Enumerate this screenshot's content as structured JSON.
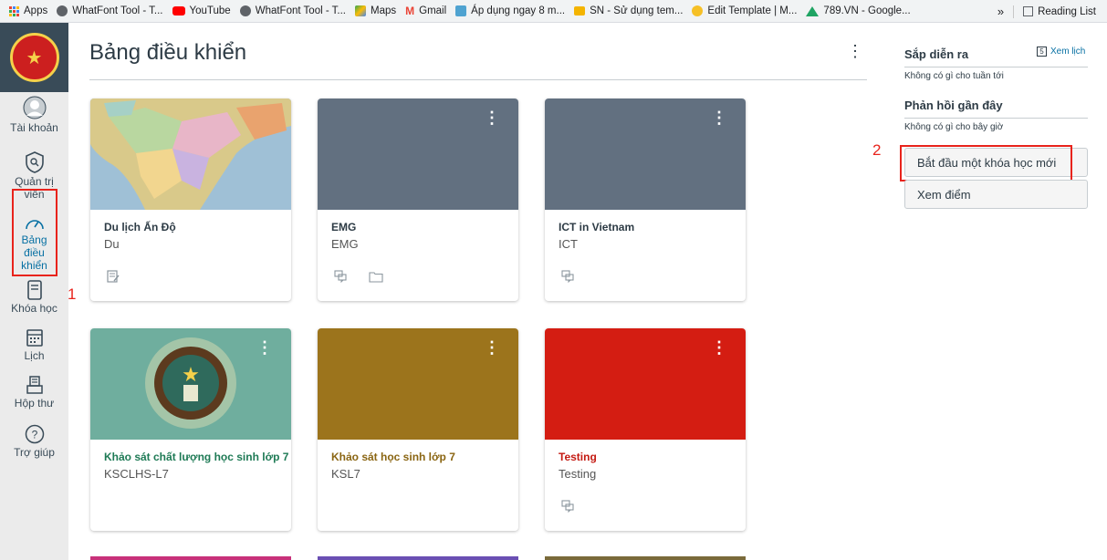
{
  "bookmarks": [
    {
      "label": "Apps",
      "icon": "apps-grid-icon",
      "color": "#4285f4"
    },
    {
      "label": "WhatFont Tool - T...",
      "icon": "globe-icon",
      "color": "#5f6368"
    },
    {
      "label": "YouTube",
      "icon": "youtube-icon",
      "color": "#ff0000"
    },
    {
      "label": "WhatFont Tool - T...",
      "icon": "globe-icon",
      "color": "#5f6368"
    },
    {
      "label": "Maps",
      "icon": "maps-icon",
      "color": "#34a853"
    },
    {
      "label": "Gmail",
      "icon": "gmail-icon",
      "color": "#ea4335"
    },
    {
      "label": "Áp dụng ngay 8 m...",
      "icon": "site-icon",
      "color": "#4fa3d1"
    },
    {
      "label": "SN - Sử dụng tem...",
      "icon": "folder-icon",
      "color": "#f4b400"
    },
    {
      "label": "Edit Template | M...",
      "icon": "template-icon",
      "color": "#f6c026"
    },
    {
      "label": "789.VN - Google...",
      "icon": "drive-icon",
      "color": "#1fa463"
    }
  ],
  "bookmarks_overflow": "»",
  "reading_list": "Reading List",
  "nav": {
    "account": "Tài khoản",
    "admin": "Quản trị viên",
    "dashboard": "Bảng điều khiển",
    "courses": "Khóa học",
    "calendar": "Lịch",
    "inbox": "Hộp thư",
    "help": "Trợ giúp"
  },
  "annotations": {
    "one": "1",
    "two": "2"
  },
  "page_title": "Bảng điều khiển",
  "cards": [
    {
      "name": "Du lịch Ấn Độ",
      "code": "Du",
      "color": "#8fb0c8",
      "name_color": "#2d3b45",
      "hero": "map"
    },
    {
      "name": "EMG",
      "code": "EMG",
      "color": "#627080",
      "name_color": "#2d3b45",
      "hero": "solid"
    },
    {
      "name": "ICT in Vietnam",
      "code": "ICT",
      "color": "#627080",
      "name_color": "#2d3b45",
      "hero": "solid"
    },
    {
      "name": "Khảo sát chất lượng học sinh lớp 7",
      "code": "KSCLHS-L7",
      "color": "#6fae9e",
      "name_color": "#1e7a55",
      "hero": "logo"
    },
    {
      "name": "Khảo sát học sinh lớp 7",
      "code": "KSL7",
      "color": "#9c741c",
      "name_color": "#8a6512",
      "hero": "solid"
    },
    {
      "name": "Testing",
      "code": "Testing",
      "color": "#d41d12",
      "name_color": "#c41a12",
      "hero": "solid"
    }
  ],
  "sidebar": {
    "upcoming_title": "Sắp diễn ra",
    "view_calendar": "Xem lịch",
    "calendar_day": "5",
    "upcoming_empty": "Không có gì cho tuần tới",
    "feedback_title": "Phản hồi gần đây",
    "feedback_empty": "Không có gì cho bây giờ",
    "start_course": "Bắt đầu một khóa học mới",
    "view_grades": "Xem điểm"
  }
}
